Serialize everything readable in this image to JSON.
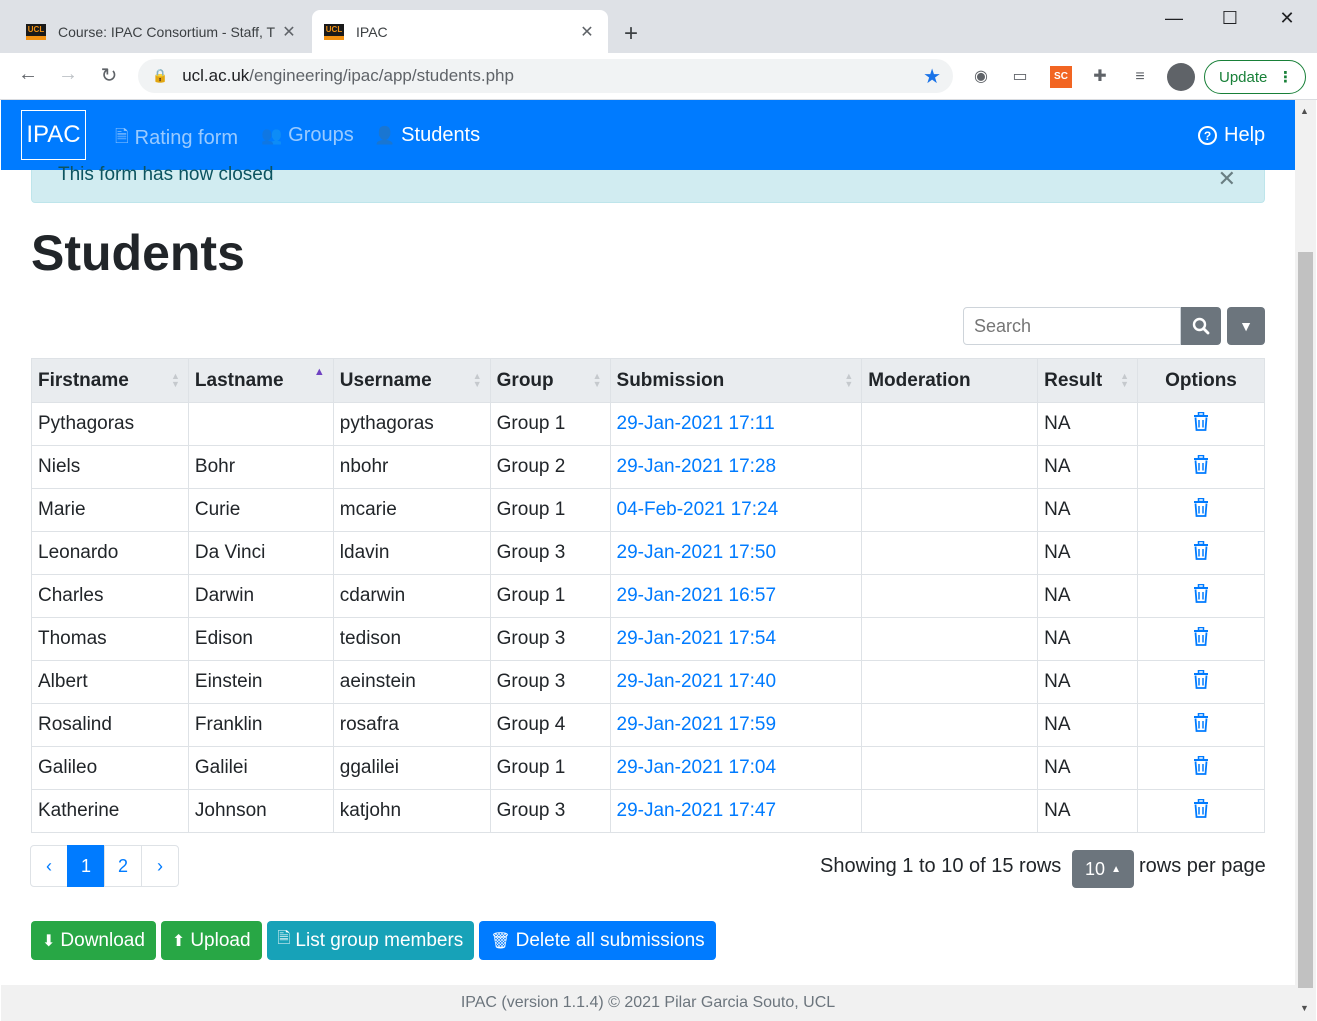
{
  "browser": {
    "tabs": [
      {
        "title": "Course: IPAC Consortium - Staff, T",
        "favicon": "UCL"
      },
      {
        "title": "IPAC",
        "favicon": "UCL"
      }
    ],
    "url_host": "ucl.ac.uk",
    "url_path": "/engineering/ipac/app/students.php",
    "update_label": "Update",
    "extension_sc": "SC"
  },
  "navbar": {
    "brand": "IPAC",
    "links": [
      {
        "label": "Rating form",
        "icon": "file-icon"
      },
      {
        "label": "Groups",
        "icon": "users-icon"
      },
      {
        "label": "Students",
        "icon": "user-icon"
      }
    ],
    "help": "Help"
  },
  "alert": {
    "text": "This form has now closed"
  },
  "page": {
    "title": "Students"
  },
  "search": {
    "placeholder": "Search"
  },
  "table": {
    "headers": [
      "Firstname",
      "Lastname",
      "Username",
      "Group",
      "Submission",
      "Moderation",
      "Result",
      "Options"
    ],
    "rows": [
      {
        "first": "Pythagoras",
        "last": "",
        "user": "pythagoras",
        "group": "Group 1",
        "submission": "29-Jan-2021 17:11",
        "moderation": "",
        "result": "NA"
      },
      {
        "first": "Niels",
        "last": "Bohr",
        "user": "nbohr",
        "group": "Group 2",
        "submission": "29-Jan-2021 17:28",
        "moderation": "",
        "result": "NA"
      },
      {
        "first": "Marie",
        "last": "Curie",
        "user": "mcarie",
        "group": "Group 1",
        "submission": "04-Feb-2021 17:24",
        "moderation": "",
        "result": "NA"
      },
      {
        "first": "Leonardo",
        "last": "Da Vinci",
        "user": "ldavin",
        "group": "Group 3",
        "submission": "29-Jan-2021 17:50",
        "moderation": "",
        "result": "NA"
      },
      {
        "first": "Charles",
        "last": "Darwin",
        "user": "cdarwin",
        "group": "Group 1",
        "submission": "29-Jan-2021 16:57",
        "moderation": "",
        "result": "NA"
      },
      {
        "first": "Thomas",
        "last": "Edison",
        "user": "tedison",
        "group": "Group 3",
        "submission": "29-Jan-2021 17:54",
        "moderation": "",
        "result": "NA"
      },
      {
        "first": "Albert",
        "last": "Einstein",
        "user": "aeinstein",
        "group": "Group 3",
        "submission": "29-Jan-2021 17:40",
        "moderation": "",
        "result": "NA"
      },
      {
        "first": "Rosalind",
        "last": "Franklin",
        "user": "rosafra",
        "group": "Group 4",
        "submission": "29-Jan-2021 17:59",
        "moderation": "",
        "result": "NA"
      },
      {
        "first": "Galileo",
        "last": "Galilei",
        "user": "ggalilei",
        "group": "Group 1",
        "submission": "29-Jan-2021 17:04",
        "moderation": "",
        "result": "NA"
      },
      {
        "first": "Katherine",
        "last": "Johnson",
        "user": "katjohn",
        "group": "Group 3",
        "submission": "29-Jan-2021 17:47",
        "moderation": "",
        "result": "NA"
      }
    ]
  },
  "pagination": {
    "prev": "‹",
    "pages": [
      "1",
      "2"
    ],
    "next": "›",
    "current": "1"
  },
  "rows_info": {
    "showing": "Showing 1 to 10 of 15 rows",
    "per_page": "10",
    "per_page_label": "rows per page"
  },
  "actions": {
    "download": "Download",
    "upload": "Upload",
    "list_members": "List group members",
    "delete_all": "Delete all submissions"
  },
  "footer": {
    "text": "IPAC (version 1.1.4) © 2021 Pilar Garcia Souto, UCL"
  },
  "colors": {
    "primary": "#007bff",
    "success": "#28a745",
    "info": "#17a2b8",
    "secondary": "#6c757d",
    "alert_bg": "#d1ecf1"
  }
}
